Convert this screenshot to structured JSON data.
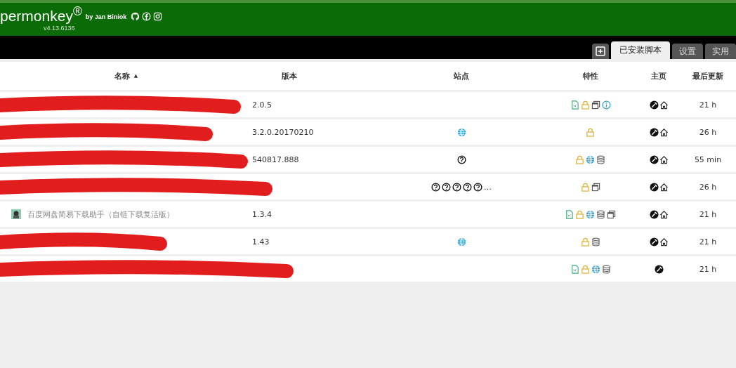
{
  "header": {
    "logo": "permonkey$^{®}$",
    "author": "by Jan Biniok",
    "version": "v4.13.6136"
  },
  "tabs": [
    {
      "kind": "add",
      "selected": false
    },
    {
      "label": "已安装脚本",
      "selected": true
    },
    {
      "label": "设置",
      "selected": false
    },
    {
      "label": "实用",
      "selected": false
    }
  ],
  "table": {
    "columns": [
      {
        "label": "名称",
        "sort_indicator": "▲"
      },
      {
        "label": "版本"
      },
      {
        "label": "站点"
      },
      {
        "label": "特性"
      },
      {
        "label": "主页"
      },
      {
        "label": "最后更新"
      }
    ],
    "rows": [
      {
        "redacted": true,
        "version": "2.0.5",
        "sites": [],
        "features": [
          {
            "kind": "file"
          },
          {
            "kind": "lock"
          },
          {
            "kind": "windows"
          },
          {
            "kind": "info"
          }
        ],
        "homepage": [
          {
            "kind": "tool"
          },
          {
            "kind": "home"
          }
        ],
        "updated": "21 h"
      },
      {
        "redacted": true,
        "version": "3.2.0.20170210",
        "sites": [
          {
            "kind": "globe"
          }
        ],
        "features": [
          {
            "kind": "lock"
          }
        ],
        "homepage": [
          {
            "kind": "tool"
          },
          {
            "kind": "home"
          }
        ],
        "updated": "26 h"
      },
      {
        "redacted": true,
        "version": "540817.888",
        "sites": [
          {
            "kind": "unknown"
          }
        ],
        "features": [
          {
            "kind": "lock"
          },
          {
            "kind": "globe"
          },
          {
            "kind": "database"
          }
        ],
        "homepage": [
          {
            "kind": "tool"
          },
          {
            "kind": "home"
          }
        ],
        "updated": "55 min"
      },
      {
        "redacted": true,
        "sites": [
          {
            "kind": "unknown"
          },
          {
            "kind": "unknown"
          },
          {
            "kind": "unknown"
          },
          {
            "kind": "unknown"
          },
          {
            "kind": "unknown"
          }
        ],
        "sites_more": "…",
        "features": [
          {
            "kind": "lock"
          },
          {
            "kind": "windows"
          }
        ],
        "homepage": [
          {
            "kind": "tool"
          },
          {
            "kind": "home"
          }
        ],
        "updated": "26 h"
      },
      {
        "redacted": false,
        "name": "百度网盘简易下载助手（自链下载复活版）",
        "version": "1.3.4",
        "sites": [],
        "features": [
          {
            "kind": "file"
          },
          {
            "kind": "lock"
          },
          {
            "kind": "globe"
          },
          {
            "kind": "database"
          },
          {
            "kind": "windows"
          }
        ],
        "homepage": [
          {
            "kind": "tool"
          },
          {
            "kind": "home"
          }
        ],
        "updated": "21 h"
      },
      {
        "redacted": true,
        "version": "1.43",
        "sites": [
          {
            "kind": "globe"
          }
        ],
        "features": [
          {
            "kind": "lock"
          },
          {
            "kind": "database"
          }
        ],
        "homepage": [
          {
            "kind": "tool"
          },
          {
            "kind": "home"
          }
        ],
        "updated": "21 h"
      },
      {
        "redacted": true,
        "sites": [],
        "features": [
          {
            "kind": "file"
          },
          {
            "kind": "lock"
          },
          {
            "kind": "globe"
          },
          {
            "kind": "database"
          }
        ],
        "homepage": [
          {
            "kind": "tool"
          }
        ],
        "updated": "21 h"
      }
    ]
  }
}
